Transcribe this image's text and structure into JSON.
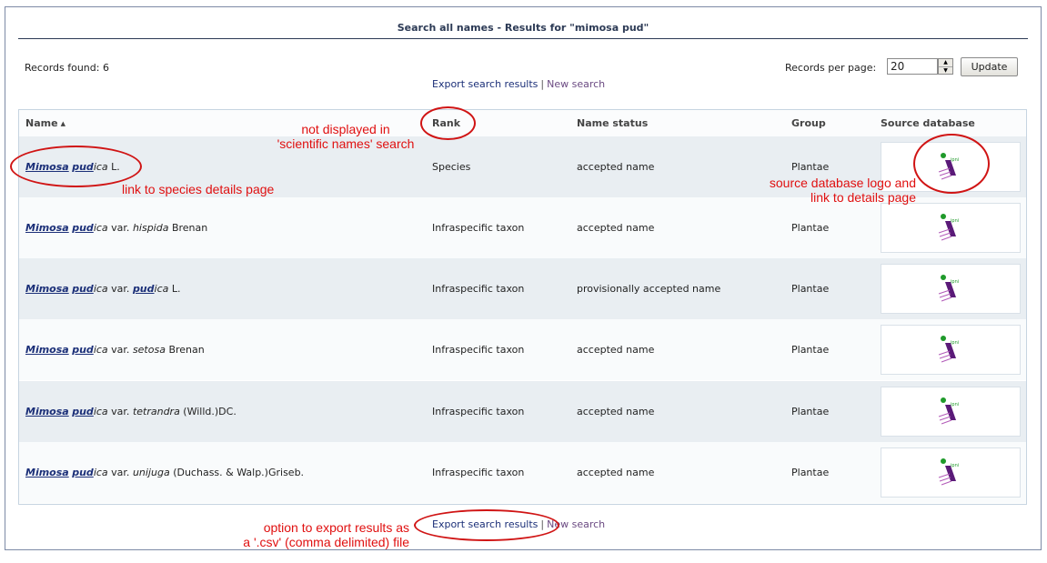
{
  "header": {
    "title": "Search all names - Results for \"mimosa pud\""
  },
  "toolbar": {
    "records_found": "Records found: 6",
    "records_per_page_label": "Records per page:",
    "records_per_page_value": "20",
    "update_label": "Update"
  },
  "links": {
    "export": "Export search results",
    "separator": "|",
    "new_search": "New search"
  },
  "table": {
    "columns": {
      "name": "Name",
      "rank": "Rank",
      "status": "Name status",
      "group": "Group",
      "source": "Source database"
    },
    "rows": [
      {
        "genus": "Mimosa",
        "species_pre": "pud",
        "species_post": "ica",
        "connector": "",
        "infra_pre": "",
        "infra_post": "",
        "author": " L.",
        "rank": "Species",
        "status": "accepted name",
        "group": "Plantae"
      },
      {
        "genus": "Mimosa",
        "species_pre": "pud",
        "species_post": "ica",
        "connector": " var. ",
        "infra_pre": "",
        "infra_post": "hispida",
        "author": " Brenan",
        "rank": "Infraspecific taxon",
        "status": "accepted name",
        "group": "Plantae"
      },
      {
        "genus": "Mimosa",
        "species_pre": "pud",
        "species_post": "ica",
        "connector": " var. ",
        "infra_pre": "pud",
        "infra_post": "ica",
        "author": " L.",
        "rank": "Infraspecific taxon",
        "status": "provisionally accepted name",
        "group": "Plantae"
      },
      {
        "genus": "Mimosa",
        "species_pre": "pud",
        "species_post": "ica",
        "connector": " var. ",
        "infra_pre": "",
        "infra_post": "setosa",
        "author": " Brenan",
        "rank": "Infraspecific taxon",
        "status": "accepted name",
        "group": "Plantae"
      },
      {
        "genus": "Mimosa",
        "species_pre": "pud",
        "species_post": "ica",
        "connector": " var. ",
        "infra_pre": "",
        "infra_post": "tetrandra",
        "author": " (Willd.)DC.",
        "rank": "Infraspecific taxon",
        "status": "accepted name",
        "group": "Plantae"
      },
      {
        "genus": "Mimosa",
        "species_pre": "pud",
        "species_post": "ica",
        "connector": " var. ",
        "infra_pre": "",
        "infra_post": "unijuga",
        "author": " (Duchass. & Walp.)Griseb.",
        "rank": "Infraspecific taxon",
        "status": "accepted name",
        "group": "Plantae"
      }
    ]
  },
  "annotations": {
    "not_displayed_line1": "not displayed in",
    "not_displayed_line2": "'scientific names' search",
    "species_link": "link to species details page",
    "source_logo_line1": "source database logo and",
    "source_logo_line2": "link to details page",
    "export_option_line1": "option to export results as",
    "export_option_line2": "a '.csv' (comma delimited) file"
  },
  "icons": {
    "sort": "sort-ascending-icon",
    "spin": "spin-arrows-icon",
    "source_logo": "ildis-logo-icon"
  },
  "colors": {
    "link": "#1b2f78",
    "visited_link": "#6b4a82",
    "row_shade": "#e9eef2",
    "annotation": "#e01010",
    "logo_purple": "#5a1a78",
    "logo_green": "#1f9a2a"
  }
}
